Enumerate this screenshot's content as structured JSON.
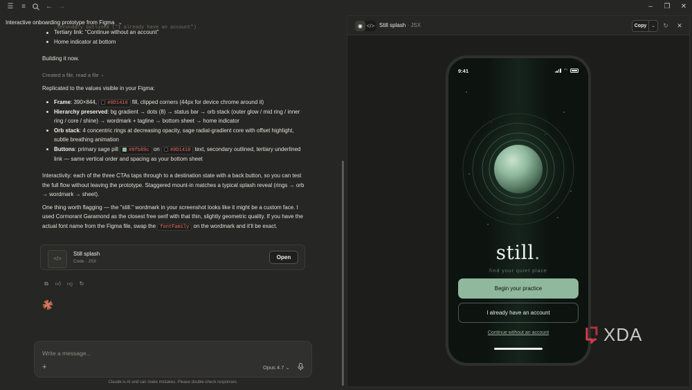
{
  "header": {
    "title": "Interactive onboarding prototype from Figma"
  },
  "chat": {
    "faded_top": "…secondary outlined (\"I already have an account\")",
    "intro_bullets": [
      "Tertiary link: \"Continue without an account\"",
      "Home indicator at bottom"
    ],
    "building": "Building it now.",
    "created_file": "Created a file, read a file",
    "replicated": "Replicated to the values visible in your Figma:",
    "frame": {
      "label": "Frame",
      "pre": ": 390×844, ",
      "code": "#0D1410",
      "post": " fill, clipped corners (44px for device chrome around it)"
    },
    "hierarchy": {
      "label": "Hierarchy preserved",
      "text": ": bg gradient → dots (8) → status bar → orb stack (outer glow / mid ring / inner ring / core / shine) → wordmark + tagline → bottom sheet → home indicator"
    },
    "orb": {
      "label": "Orb stack",
      "text": ": 4 concentric rings at decreasing opacity, sage radial-gradient core with offset highlight, subtle breathing animation"
    },
    "buttons": {
      "label": "Buttons",
      "pre": ": primary sage pill ",
      "code1": "#8fb89c",
      "mid": " on ",
      "code2": "#0D1410",
      "post": " text, secondary outlined, tertiary underlined link — same vertical order and spacing as your bottom sheet"
    },
    "interactivity": "Interactivity: each of the three CTAs taps through to a destination state with a back button, so you can test the full flow without leaving the prototype. Staggered mount-in matches a typical splash reveal (rings → orb → wordmark → sheet).",
    "flagging_pre": "One thing worth flagging — the \"still.\" wordmark in your screenshot looks like it might be a custom face. I used Cormorant Garamond as the closest free serif with that thin, slightly geometric quality. If you have the actual font name from the Figma file, swap the ",
    "flagging_code": "fontFamily",
    "flagging_post": " on the wordmark and it'll be exact."
  },
  "artifact_card": {
    "name": "Still splash",
    "sub": "Code · JSX",
    "open_label": "Open"
  },
  "composer": {
    "placeholder": "Write a message...",
    "model": "Opus 4.7",
    "disclaimer": "Claude is AI and can make mistakes. Please double-check responses."
  },
  "panel": {
    "title": "Still splash",
    "type": "· JSX",
    "copy_label": "Copy"
  },
  "phone": {
    "time": "9:41",
    "wordmark": "still",
    "wordmark_dot": ".",
    "tagline": "find your quiet place",
    "primary_cta": "Begin your practice",
    "secondary_cta": "I already have an account",
    "tertiary_cta": "Continue without an account"
  },
  "watermark": {
    "text": "XDA"
  },
  "colors": {
    "sage": "#8fb89c",
    "bg_dark": "#0D1410",
    "code_red": "#e86a5e"
  }
}
